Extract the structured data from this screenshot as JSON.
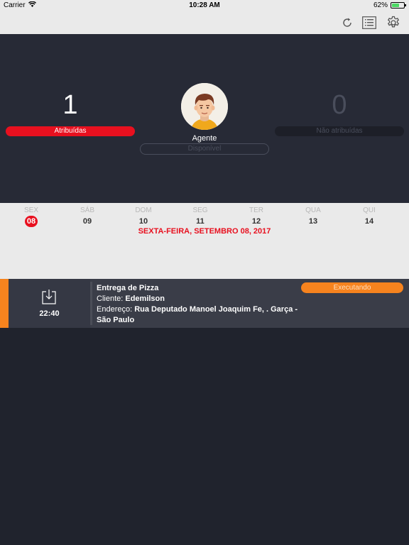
{
  "status_bar": {
    "carrier": "Carrier",
    "time": "10:28 AM",
    "battery": "62%",
    "battery_level": 0.62
  },
  "toolbar": {
    "icons": [
      "refresh-icon",
      "list-icon",
      "settings-icon"
    ]
  },
  "summary": {
    "assigned_count": "1",
    "assigned_label": "Atribuídas",
    "agent_label": "Agente",
    "agent_status": "Disponível",
    "unassigned_count": "0",
    "unassigned_label": "Não atribuídas"
  },
  "calendar": {
    "days": [
      {
        "name": "SEX",
        "num": "08"
      },
      {
        "name": "SÁB",
        "num": "09"
      },
      {
        "name": "DOM",
        "num": "10"
      },
      {
        "name": "SEG",
        "num": "11"
      },
      {
        "name": "TER",
        "num": "12"
      },
      {
        "name": "QUA",
        "num": "13"
      },
      {
        "name": "QUI",
        "num": "14"
      }
    ],
    "selected_index": 0,
    "full_date": "SEXTA-FEIRA, SETEMBRO 08, 2017"
  },
  "task": {
    "time": "22:40",
    "title": "Entrega de Pizza",
    "client_label": "Cliente:",
    "client_name": "Edemilson",
    "address_label": "Endereço:",
    "address": "Rua Deputado Manoel Joaquim Fe, . Garça - São Paulo",
    "status": "Executando",
    "accent_color": "#f6831e"
  },
  "colors": {
    "accent_red": "#e8101f",
    "accent_orange": "#f6831e",
    "background": "#20232d"
  }
}
